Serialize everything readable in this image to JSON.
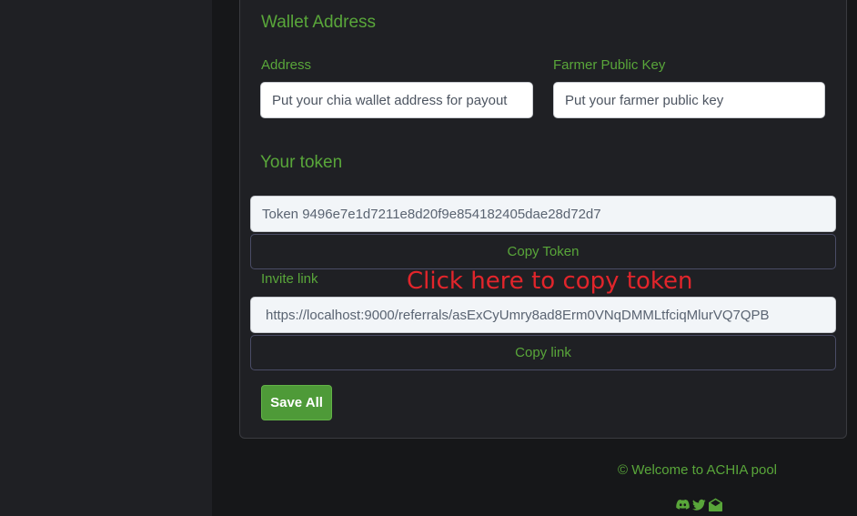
{
  "wallet": {
    "title": "Wallet Address",
    "address_label": "Address",
    "address_placeholder": "Put your chia wallet address for payout",
    "farmer_label": "Farmer Public Key",
    "farmer_placeholder": "Put your farmer public key"
  },
  "token": {
    "title": "Your token",
    "value": "Token 9496e7e1d7211e8d20f9e854182405dae28d72d7",
    "copy_label": "Copy Token"
  },
  "invite": {
    "label": "Invite link",
    "value": "https://localhost:9000/referrals/asExCyUmry8ad8Erm0VNqDMMLtfciqMlurVQ7QPB",
    "copy_label": "Copy link"
  },
  "annotation": "Click here to copy token",
  "save_label": "Save All",
  "footer": {
    "text": "© Welcome to ACHIA pool",
    "icons": [
      "discord-icon",
      "twitter-icon",
      "envelope-open-icon"
    ]
  },
  "colors": {
    "accent": "#59a63a",
    "button_green": "#4e9a38",
    "annotation_red": "#e2252b"
  }
}
